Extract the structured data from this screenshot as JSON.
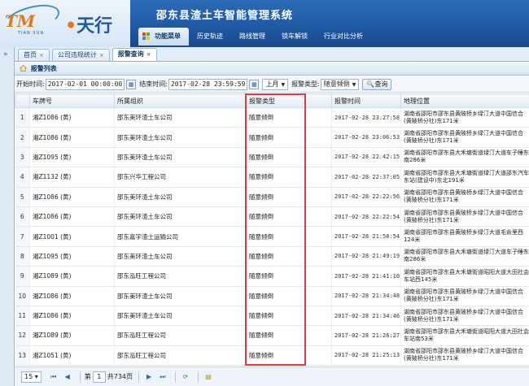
{
  "logo": {
    "brand_left": "TM",
    "brand_sub": "TIAN XUN",
    "brand_right": "天行",
    "brand_dot": "•"
  },
  "app_title": "邵东县渣土车智能管理系统",
  "menu": [
    {
      "label": "功能菜单",
      "active": true
    },
    {
      "label": "历史轨迹",
      "active": false
    },
    {
      "label": "路线管理",
      "active": false
    },
    {
      "label": "锁车解锁",
      "active": false
    },
    {
      "label": "行业对比分析",
      "active": false
    }
  ],
  "tabs": [
    {
      "label": "首页",
      "close": "×",
      "active": false
    },
    {
      "label": "公司违规统计",
      "close": "×",
      "active": false
    },
    {
      "label": "报警查询",
      "close": "×",
      "active": true
    }
  ],
  "panel_title": "报警列表",
  "filter": {
    "start_label": "开始时间:",
    "start_value": "2017-02-01 00:00:00",
    "end_label": "结束时间:",
    "end_value": "2017-02-28 23:59:59",
    "range_value": "上月",
    "type_label": "报警类型:",
    "type_value": "随意倾倒",
    "query_label": "查询",
    "calendar_icon": "calendar-icon",
    "search_icon": "search-icon"
  },
  "table": {
    "columns": [
      "",
      "车牌号",
      "所属组织",
      "报警类型",
      "报警时间",
      "地理位置"
    ],
    "rows": [
      {
        "no": "1",
        "plate": "湘Z1086 (黄)",
        "org": "邵东美环渣土车公司",
        "type": "随意倾倒",
        "time": "2017-02-28 23:27:58",
        "addr": "湖南省邵阳市邵东县黄陂桥乡绿汀大道中国信合(黄陂桥分社)东171米"
      },
      {
        "no": "2",
        "plate": "湘Z1086 (黄)",
        "org": "邵东美环渣土车公司",
        "type": "随意倾倒",
        "time": "2017-02-28 23:06:53",
        "addr": "湖南省邵阳市邵东县黄陂桥乡绿汀大道中国信合(黄陂桥分社)东171米"
      },
      {
        "no": "3",
        "plate": "湘Z1095 (黄)",
        "org": "邵东美环渣土车公司",
        "type": "随意倾倒",
        "time": "2017-02-28 22:42:15",
        "addr": "湖南省邵阳市邵东县大禾塘街道绿汀大道车子睡东南286米"
      },
      {
        "no": "4",
        "plate": "湘Z1132 (黄)",
        "org": "邵东兴华工程公司",
        "type": "随意倾倒",
        "time": "2017-02-28 22:37:05",
        "addr": "湖南省邵阳市邵东县大禾塘街道绿汀大道邵东汽车东站(建设中)东北191米"
      },
      {
        "no": "5",
        "plate": "湘Z1086 (黄)",
        "org": "邵东美环渣土车公司",
        "type": "随意倾倒",
        "time": "2017-02-28 22:22:56",
        "addr": "湖南省邵阳市邵东县黄陂桥乡绿汀大道中国信合(黄陂桥分社)东171米"
      },
      {
        "no": "6",
        "plate": "湘Z1086 (黄)",
        "org": "邵东美环渣土车公司",
        "type": "随意倾倒",
        "time": "2017-02-28 22:22:54",
        "addr": "湖南省邵阳市邵东县黄陂桥乡绿汀大道中国信合(黄陂桥分社)东171米"
      },
      {
        "no": "7",
        "plate": "湘Z1001 (黄)",
        "org": "邵东嘉宇渣土运输公司",
        "type": "随意倾倒",
        "time": "2017-02-28 21:58:54",
        "addr": "湖南省邵阳市邵东县黄陂桥乡绿汀大道毛俞里西124米"
      },
      {
        "no": "8",
        "plate": "湘Z1095 (黄)",
        "org": "邵东美环渣土车公司",
        "type": "随意倾倒",
        "time": "2017-02-28 21:49:19",
        "addr": "湖南省邵阳市邵东县大禾塘街道绿汀大道车子睡东南286米"
      },
      {
        "no": "9",
        "plate": "湘Z1089 (黄)",
        "org": "邵东泓旺工程公司",
        "type": "随意倾倒",
        "time": "2017-02-28 21:41:10",
        "addr": "湖南省邵阳市邵东县大禾塘街道昭阳大道大田社会车站西145米"
      },
      {
        "no": "10",
        "plate": "湘Z1086 (黄)",
        "org": "邵东美环渣土车公司",
        "type": "随意倾倒",
        "time": "2017-02-28 21:34:48",
        "addr": "湖南省邵阳市邵东县黄陂桥乡绿汀大道中国信合(黄陂桥分社)东171米"
      },
      {
        "no": "11",
        "plate": "湘Z1086 (黄)",
        "org": "邵东美环渣土车公司",
        "type": "随意倾倒",
        "time": "2017-02-28 21:34:46",
        "addr": "湖南省邵阳市邵东县黄陂桥乡绿汀大道中国信合(黄陂桥分社)东171米"
      },
      {
        "no": "12",
        "plate": "湘Z1089 (黄)",
        "org": "邵东泓旺工程公司",
        "type": "随意倾倒",
        "time": "2017-02-28 21:26:27",
        "addr": "湖南省邵阳市邵东县大禾塘街道昭阳大道大田社会车站南53米"
      },
      {
        "no": "13",
        "plate": "湘Z1051 (黄)",
        "org": "邵东泓旺工程公司",
        "type": "随意倾倒",
        "time": "2017-02-28 21:25:13",
        "addr": "湖南省邵阳市邵东县黄陂桥乡绿汀大道中国信合(黄陂桥分社)东171米"
      }
    ]
  },
  "pager": {
    "page_size": "15",
    "page_label": "第",
    "page_value": "1",
    "total_label": "共734页",
    "first_icon": "first-page-icon",
    "prev_icon": "prev-page-icon",
    "next_icon": "next-page-icon",
    "last_icon": "last-page-icon",
    "refresh_icon": "refresh-icon",
    "export_icon": "export-icon"
  },
  "colors": {
    "header": "#1f58a3",
    "highlight": "#e03a3a",
    "accent_orange": "#e07a18"
  }
}
